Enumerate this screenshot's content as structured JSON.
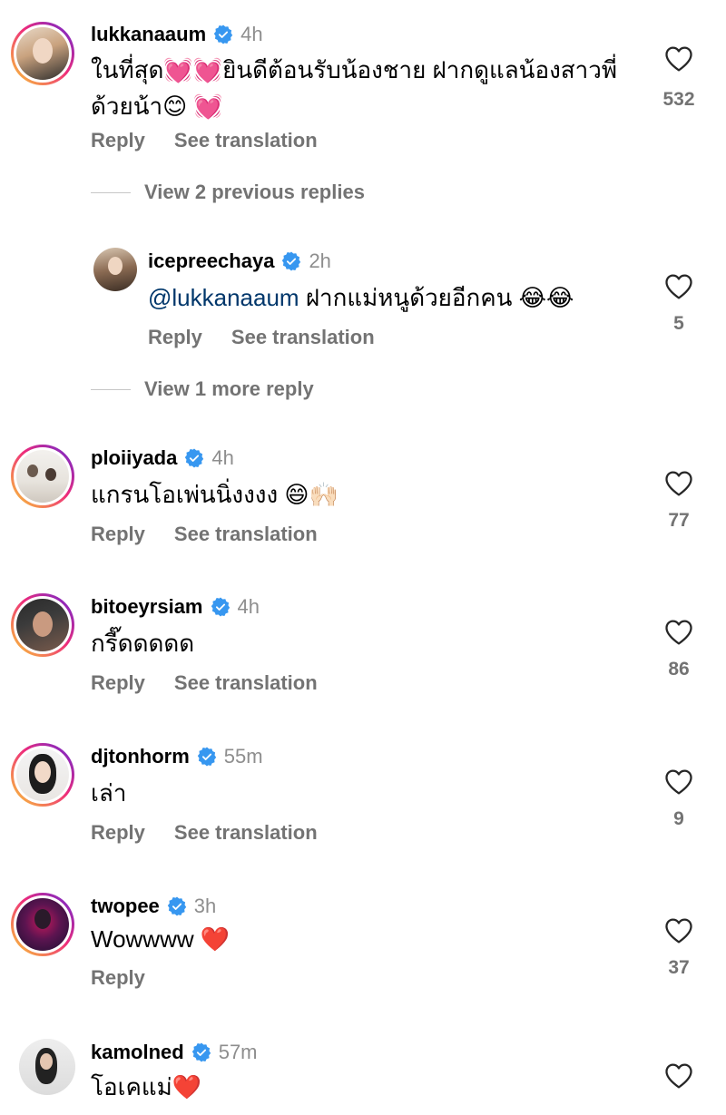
{
  "labels": {
    "reply": "Reply",
    "see_translation": "See translation"
  },
  "colors": {
    "verified": "#3797f0",
    "secondary_text": "#737373",
    "mention": "#00376b"
  },
  "comments": [
    {
      "username": "lukkanaaum",
      "time": "4h",
      "text_line1": "ในที่สุด💓💓ยินดีต้อนรับน้องชาย ฝากดูแลน้องสาวพี่",
      "text_line2": "ด้วยน้า😊 💓",
      "likes": "532",
      "view_replies": "View 2 previous replies",
      "reply": {
        "username": "icepreechaya",
        "time": "2h",
        "mention": "@lukkanaaum",
        "text": " ฝากแม่หนูด้วยอีกคน 😂😂",
        "likes": "5"
      },
      "more_replies": "View 1 more reply"
    },
    {
      "username": "ploiiyada",
      "time": "4h",
      "text": "แกรนโอเพ่นนิ่งงงง 😄🙌🏻",
      "likes": "77"
    },
    {
      "username": "bitoeyrsiam",
      "time": "4h",
      "text": "กรี๊ดดดดด",
      "likes": "86"
    },
    {
      "username": "djtonhorm",
      "time": "55m",
      "text": "เล่า",
      "likes": "9"
    },
    {
      "username": "twopee",
      "time": "3h",
      "text": "Wowwww ❤️",
      "likes": "37"
    },
    {
      "username": "kamolned",
      "time": "57m",
      "text": "โอเคแม่❤️",
      "likes": ""
    }
  ]
}
